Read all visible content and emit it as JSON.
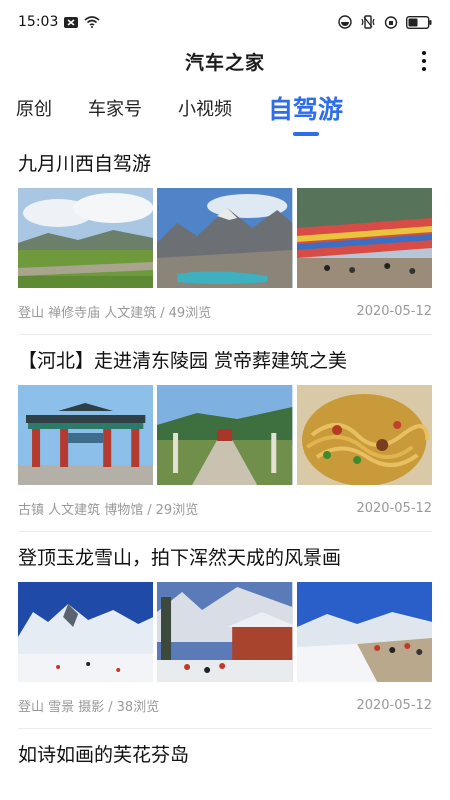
{
  "status_bar": {
    "time": "15:03",
    "icons": [
      "notification-icon",
      "wifi-icon",
      "eye-comfort-icon",
      "vibrate-icon",
      "alarm-icon",
      "battery-icon"
    ]
  },
  "header": {
    "title": "汽车之家",
    "menu_icon": "more-vertical-icon"
  },
  "tabs": [
    {
      "label": "原创",
      "active": false
    },
    {
      "label": "车家号",
      "active": false
    },
    {
      "label": "小视频",
      "active": false
    },
    {
      "label": "自驾游",
      "active": true
    }
  ],
  "colors": {
    "accent": "#2f6ee8",
    "meta_text": "#999999"
  },
  "articles": [
    {
      "title": "九月川西自驾游",
      "tags": "登山 禅修寺庙 人文建筑",
      "sep": "/",
      "views": "49浏览",
      "date": "2020-05-12"
    },
    {
      "title": "【河北】走进清东陵园  赏帝葬建筑之美",
      "tags": "古镇 人文建筑 博物馆",
      "sep": "/",
      "views": "29浏览",
      "date": "2020-05-12"
    },
    {
      "title": "登顶玉龙雪山，拍下浑然天成的风景画",
      "tags": "登山 雪景 摄影",
      "sep": "/",
      "views": "38浏览",
      "date": "2020-05-12"
    },
    {
      "title": "如诗如画的芙花芬岛",
      "tags": "",
      "sep": "",
      "views": "",
      "date": ""
    }
  ]
}
